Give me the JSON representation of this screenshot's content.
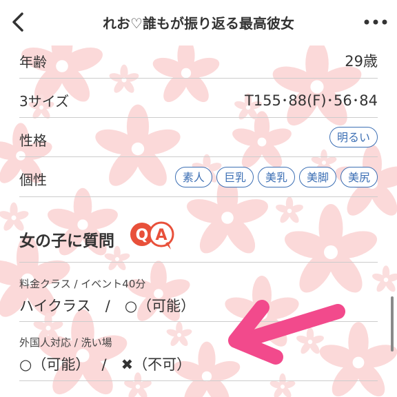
{
  "header": {
    "title": "れお♡誰もが振り返る最高彼女"
  },
  "profile": {
    "rows": [
      {
        "label": "年齢",
        "value": "29歳"
      },
      {
        "label": "3サイズ",
        "value": "T155･88(F)･56･84"
      },
      {
        "label": "性格",
        "value": "明るい"
      },
      {
        "label": "個性",
        "tags": [
          "素人",
          "巨乳",
          "美乳",
          "美脚",
          "美尻"
        ]
      }
    ]
  },
  "qa_section": {
    "title": "女の子に質問",
    "badge_q": "Q",
    "badge_a": "A",
    "items": [
      {
        "question": "料金クラス / イベント40分",
        "answer": "ハイクラス　/　○（可能）"
      },
      {
        "question": "外国人対応 / 洗い場",
        "answer": "○（可能）　 /　✖（不可）"
      }
    ]
  },
  "colors": {
    "accent_blue": "#3c6fb4",
    "qa_red": "#e8503a",
    "arrow_pink": "#f24a8c",
    "flower_pink": "#f9d3d3"
  },
  "icons": {
    "back": "chevron-left-icon",
    "more": "more-dots-icon"
  }
}
